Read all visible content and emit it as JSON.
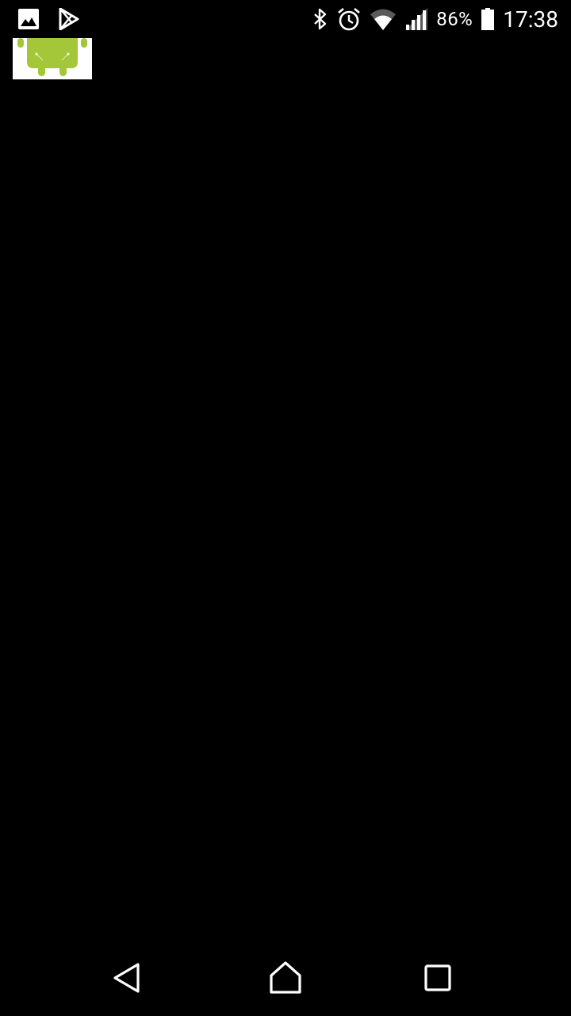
{
  "status_bar": {
    "battery_percent": "86%",
    "time": "17:38",
    "icons": {
      "notification_1": "image-icon",
      "notification_2": "play-store-icon",
      "bluetooth": "bluetooth-icon",
      "alarm": "alarm-icon",
      "wifi": "wifi-icon",
      "signal": "signal-icon",
      "battery": "battery-icon"
    }
  },
  "content": {
    "thumbnail": "android-robot-icon"
  },
  "nav_bar": {
    "back": "back-icon",
    "home": "home-icon",
    "recents": "recents-icon"
  },
  "colors": {
    "background": "#000000",
    "android_green": "#a4c639",
    "status_text": "#ffffff"
  }
}
